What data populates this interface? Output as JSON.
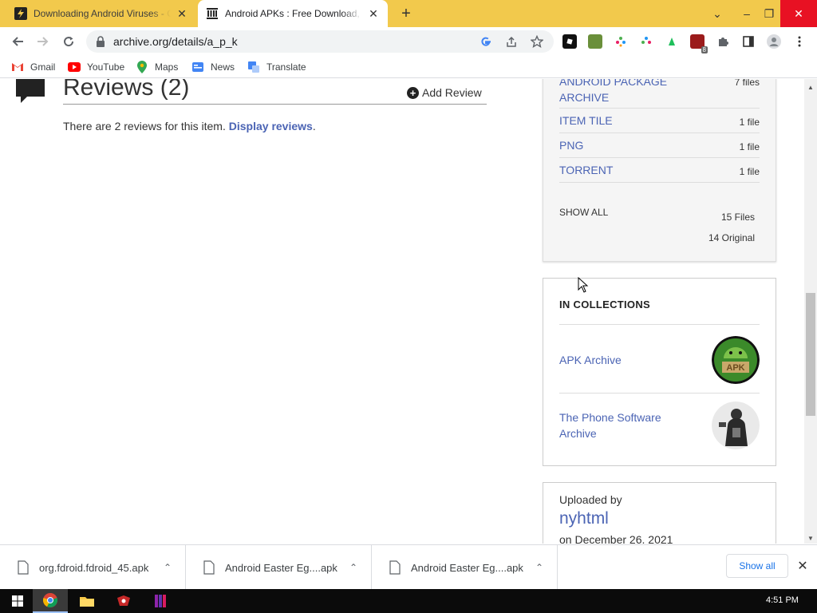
{
  "browser": {
    "tabs": [
      {
        "title": "Downloading Android Viruses - C",
        "close": "✕"
      },
      {
        "title": "Android APKs : Free Download, B",
        "close": "✕"
      }
    ],
    "new_tab": "+",
    "url": "archive.org/details/a_p_k",
    "window": {
      "dropdown": "⌄",
      "minimize": "–",
      "maximize": "❐",
      "close": "✕"
    }
  },
  "bookmarks": [
    {
      "label": "Gmail",
      "icon": "gmail-icon"
    },
    {
      "label": "YouTube",
      "icon": "youtube-icon"
    },
    {
      "label": "Maps",
      "icon": "maps-icon"
    },
    {
      "label": "News",
      "icon": "news-icon"
    },
    {
      "label": "Translate",
      "icon": "translate-icon"
    }
  ],
  "reviews": {
    "title": "Reviews (2)",
    "add_label": "Add Review",
    "text": "There are 2 reviews for this item.",
    "link": "Display reviews",
    "period": "."
  },
  "files": {
    "rows": [
      {
        "name": "ANDROID PACKAGE ARCHIVE",
        "count": "7 files"
      },
      {
        "name": "ITEM TILE",
        "count": "1 file"
      },
      {
        "name": "PNG",
        "count": "1 file"
      },
      {
        "name": "TORRENT",
        "count": "1 file"
      }
    ],
    "show_all": "SHOW ALL",
    "total": "15 Files",
    "original": "14 Original"
  },
  "collections": {
    "heading": "IN COLLECTIONS",
    "items": [
      {
        "name": "APK Archive",
        "thumb_text": "APK"
      },
      {
        "name": "The Phone Software Archive"
      }
    ]
  },
  "uploader": {
    "label": "Uploaded by",
    "name": "nyhtml",
    "date": "on December 26, 2021"
  },
  "downloads": {
    "items": [
      {
        "name": "org.fdroid.fdroid_45.apk"
      },
      {
        "name": "Android Easter Eg....apk"
      },
      {
        "name": "Android Easter Eg....apk"
      }
    ],
    "show_all": "Show all",
    "close": "✕"
  },
  "taskbar": {
    "clock": "4:51 PM"
  },
  "colors": {
    "tab_strip": "#f2c94c",
    "link": "#4b64b4",
    "close_red": "#e81123"
  }
}
